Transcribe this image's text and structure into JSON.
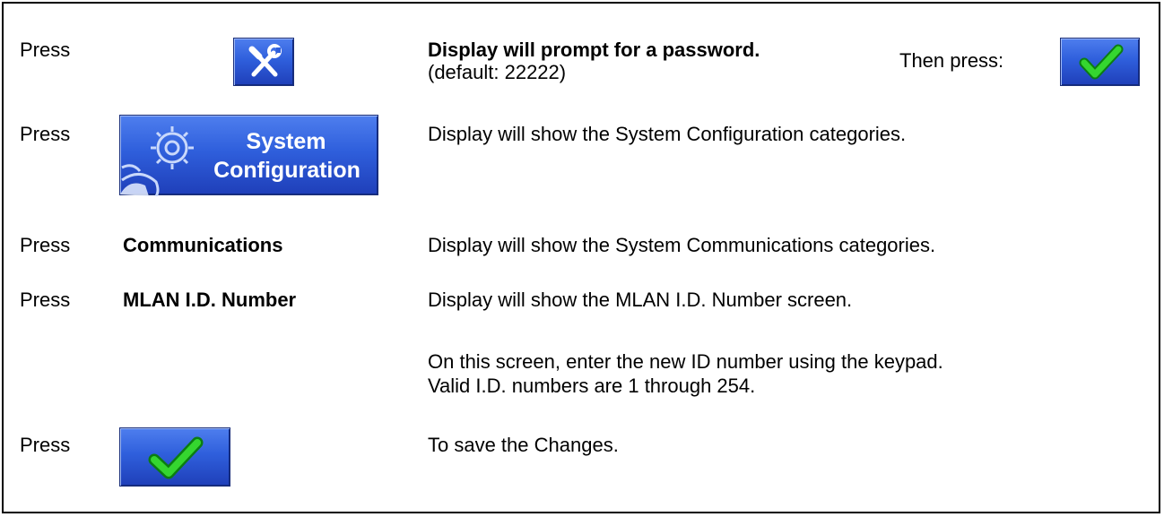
{
  "row1": {
    "press": "Press",
    "prompt_bold": "Display will prompt for a password.",
    "prompt_default": "(default: 22222)",
    "then_press": "Then press:",
    "tools_icon": "wrench-screwdriver-icon",
    "check_icon": "checkmark-icon"
  },
  "row2": {
    "press": "Press",
    "button_line1": "System",
    "button_line2": "Configuration",
    "gear_icon": "gear-icon",
    "description": "Display will show the System Configuration categories."
  },
  "row3": {
    "press": "Press",
    "item": "Communications",
    "description": "Display will show the System Communications categories."
  },
  "row4": {
    "press": "Press",
    "item": "MLAN I.D. Number",
    "description": "Display will show the MLAN I.D. Number screen."
  },
  "note": {
    "line1": "On this screen, enter the new ID number using the keypad.",
    "line2": "Valid I.D. numbers are 1 through 254."
  },
  "row5": {
    "press": "Press",
    "check_icon": "checkmark-icon",
    "description": "To save the Changes."
  },
  "colors": {
    "button_blue": "#2f5fdc",
    "check_green": "#22c51e",
    "border": "#000000"
  }
}
